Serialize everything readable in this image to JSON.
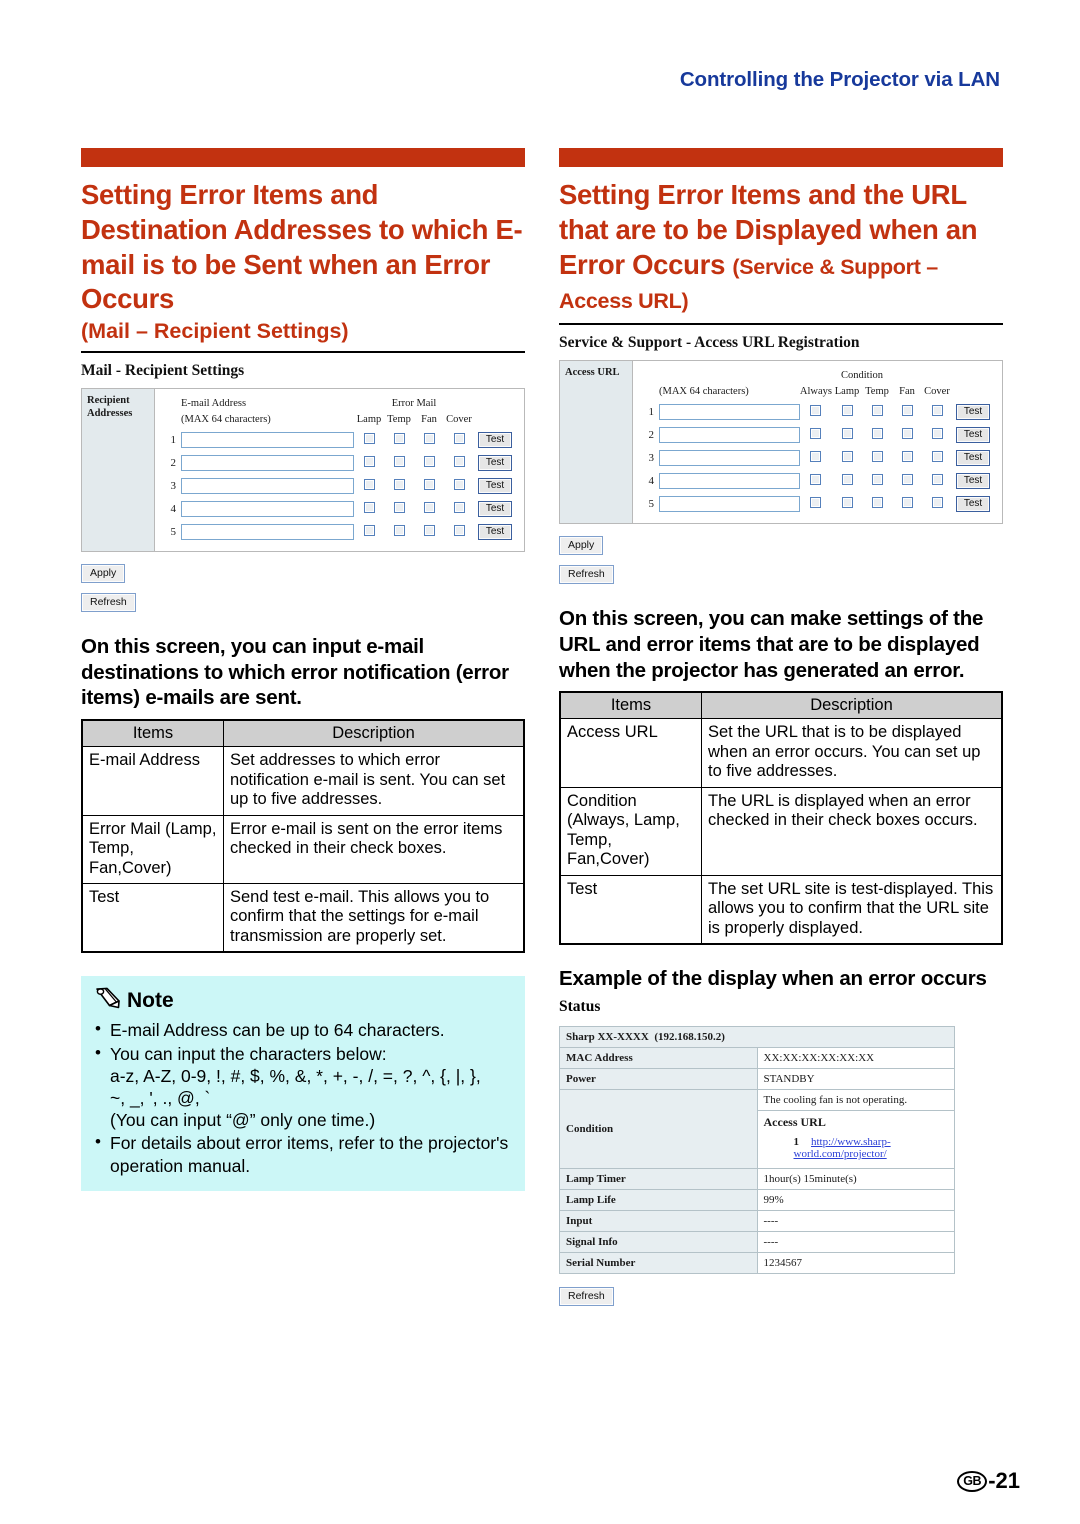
{
  "running_head": "Controlling the Projector via LAN",
  "folio": {
    "region": "GB",
    "page": "-21"
  },
  "left": {
    "title_main": "Setting Error Items and Destination Addresses to which E-mail is to be Sent when an Error Occurs",
    "title_sub": "(Mail – Recipient Settings)",
    "screenshot": {
      "heading": "Mail - Recipient Settings",
      "side_label": "Recipient Addresses",
      "col_address": "E-mail Address",
      "col_address_note": "(MAX 64 characters)",
      "group_label": "Error Mail",
      "check_columns": [
        "Lamp",
        "Temp",
        "Fan",
        "Cover"
      ],
      "rows": [
        "1",
        "2",
        "3",
        "4",
        "5"
      ],
      "test_label": "Test",
      "apply_label": "Apply",
      "refresh_label": "Refresh",
      "field_value": ""
    },
    "intro": "On this screen, you can input e-mail destinations to which error notification (error items) e-mails are sent.",
    "table": {
      "headers": [
        "Items",
        "Description"
      ],
      "rows": [
        [
          "E-mail Address",
          "Set addresses to which error notification e-mail is sent. You can set up to five addresses."
        ],
        [
          "Error Mail (Lamp, Temp, Fan,Cover)",
          "Error e-mail is sent on the error items checked in their check boxes."
        ],
        [
          "Test",
          "Send test e-mail. This allows you to confirm that the settings for e-mail transmission are properly set."
        ]
      ]
    },
    "note": {
      "title": "Note",
      "items": [
        "E-mail Address can be up to 64 characters.",
        "You can input the characters below:",
        "For details about error items, refer to the projector's operation manual."
      ],
      "charset_line1": "a-z, A-Z, 0-9, !, #, $, %, &, *, +, -, /, =, ?, ^, {, |, },",
      "charset_line2": "~, _, ', ., @, `",
      "charset_note": "(You can input “@” only one time.)"
    }
  },
  "right": {
    "title_main": "Setting Error Items and the URL that are to be Displayed when an Error Occurs",
    "title_sub": "(Service & Support – Access URL)",
    "screenshot": {
      "heading": "Service & Support - Access URL Registration",
      "side_label": "Access URL",
      "col_address_note": "(MAX 64 characters)",
      "group_label": "Condition",
      "check_columns": [
        "Always",
        "Lamp",
        "Temp",
        "Fan",
        "Cover"
      ],
      "rows": [
        "1",
        "2",
        "3",
        "4",
        "5"
      ],
      "test_label": "Test",
      "apply_label": "Apply",
      "refresh_label": "Refresh",
      "field_value": ""
    },
    "intro": "On this screen, you can make settings of the URL and error items that are to be displayed when the projector has generated an error.",
    "table": {
      "headers": [
        "Items",
        "Description"
      ],
      "rows": [
        [
          "Access URL",
          "Set the URL that is to be displayed when an error occurs. You can set up to five addresses."
        ],
        [
          "Condition (Always, Lamp, Temp, Fan,Cover)",
          "The URL is displayed when an error checked in their check boxes occurs."
        ],
        [
          "Test",
          "The set URL site is test-displayed. This allows you to confirm that the URL site is properly displayed."
        ]
      ]
    },
    "example_heading": "Example of the display when an error occurs",
    "status": {
      "label": "Status",
      "device_name": "Sharp XX-XXXX",
      "device_ip": "(192.168.150.2)",
      "rows": [
        {
          "key": "MAC Address",
          "value": "XX:XX:XX:XX:XX:XX"
        },
        {
          "key": "Power",
          "value": "STANDBY"
        }
      ],
      "condition_key": "Condition",
      "condition_message": "The cooling fan is not operating.",
      "condition_url_label": "Access URL",
      "condition_url_index": "1",
      "condition_url": "http://www.sharp-world.com/projector/",
      "rows2": [
        {
          "key": "Lamp Timer",
          "value": "1hour(s) 15minute(s)"
        },
        {
          "key": "Lamp Life",
          "value": "99%"
        },
        {
          "key": "Input",
          "value": "----"
        },
        {
          "key": "Signal Info",
          "value": "----"
        },
        {
          "key": "Serial Number",
          "value": "1234567"
        }
      ],
      "refresh_label": "Refresh"
    }
  },
  "colors": {
    "accent_orange": "#c23210",
    "head_blue": "#17399b",
    "note_bg": "#ccf7f7",
    "table_header_gray": "#cfcfcf",
    "ui_panel_blue": "#e3eaed"
  }
}
